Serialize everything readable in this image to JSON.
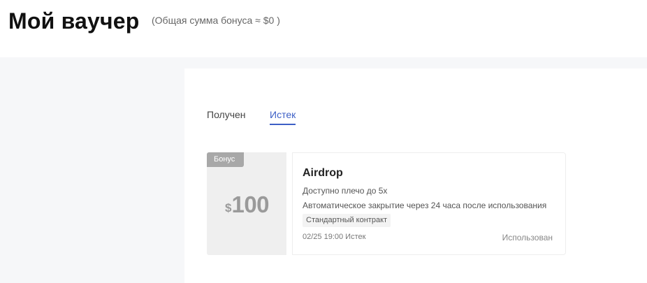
{
  "header": {
    "title": "Мой ваучер",
    "total_bonus": "(Общая сумма бонуса ≈ $0 )"
  },
  "tabs": [
    {
      "label": "Получен",
      "active": false
    },
    {
      "label": "Истек",
      "active": true
    }
  ],
  "colors": {
    "accent": "#3d5fc6",
    "background": "#f6f7f9",
    "badge": "#a8a8a8"
  },
  "vouchers": [
    {
      "badge": "Бонус",
      "currency": "$",
      "amount": "100",
      "title": "Airdrop",
      "line1": "Доступно плечо до 5x",
      "line2": "Автоматическое закрытие через 24 часа после использования",
      "tag": "Стандартный контракт",
      "date": "02/25 19:00 Истек",
      "status": "Использован"
    }
  ]
}
